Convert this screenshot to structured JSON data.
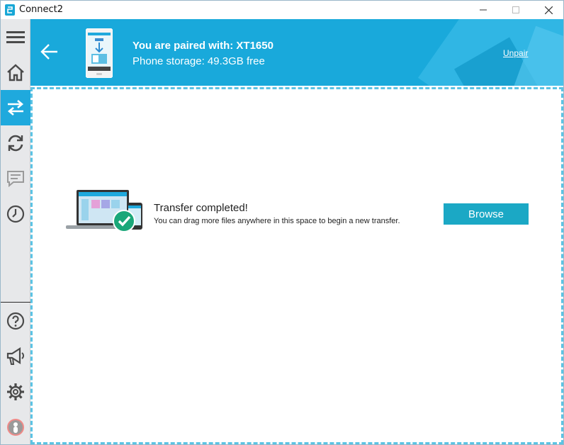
{
  "window": {
    "title": "Connect2",
    "controls": [
      "minimize",
      "maximize",
      "close"
    ]
  },
  "sidebar": {
    "items": [
      {
        "icon": "menu-icon",
        "active": false
      },
      {
        "icon": "home-icon",
        "active": false
      },
      {
        "icon": "transfer-icon",
        "active": true
      },
      {
        "icon": "sync-icon",
        "active": false
      },
      {
        "icon": "message-icon",
        "active": false
      },
      {
        "icon": "clock-icon",
        "active": false
      }
    ],
    "bottom_items": [
      {
        "icon": "help-icon"
      },
      {
        "icon": "megaphone-icon"
      },
      {
        "icon": "gear-icon"
      },
      {
        "icon": "user-icon"
      }
    ]
  },
  "header": {
    "paired_label": "You are paired with: XT1650",
    "storage_label": "Phone storage: 49.3GB free",
    "unpair_label": "Unpair"
  },
  "transfer": {
    "status_title": "Transfer completed!",
    "status_sub": "You can drag more files anywhere in this space to begin a new transfer.",
    "browse_label": "Browse"
  },
  "colors": {
    "accent": "#19a9db",
    "button": "#1ba8c5",
    "success": "#1aa779",
    "dashed_border": "#5bc3e4"
  }
}
